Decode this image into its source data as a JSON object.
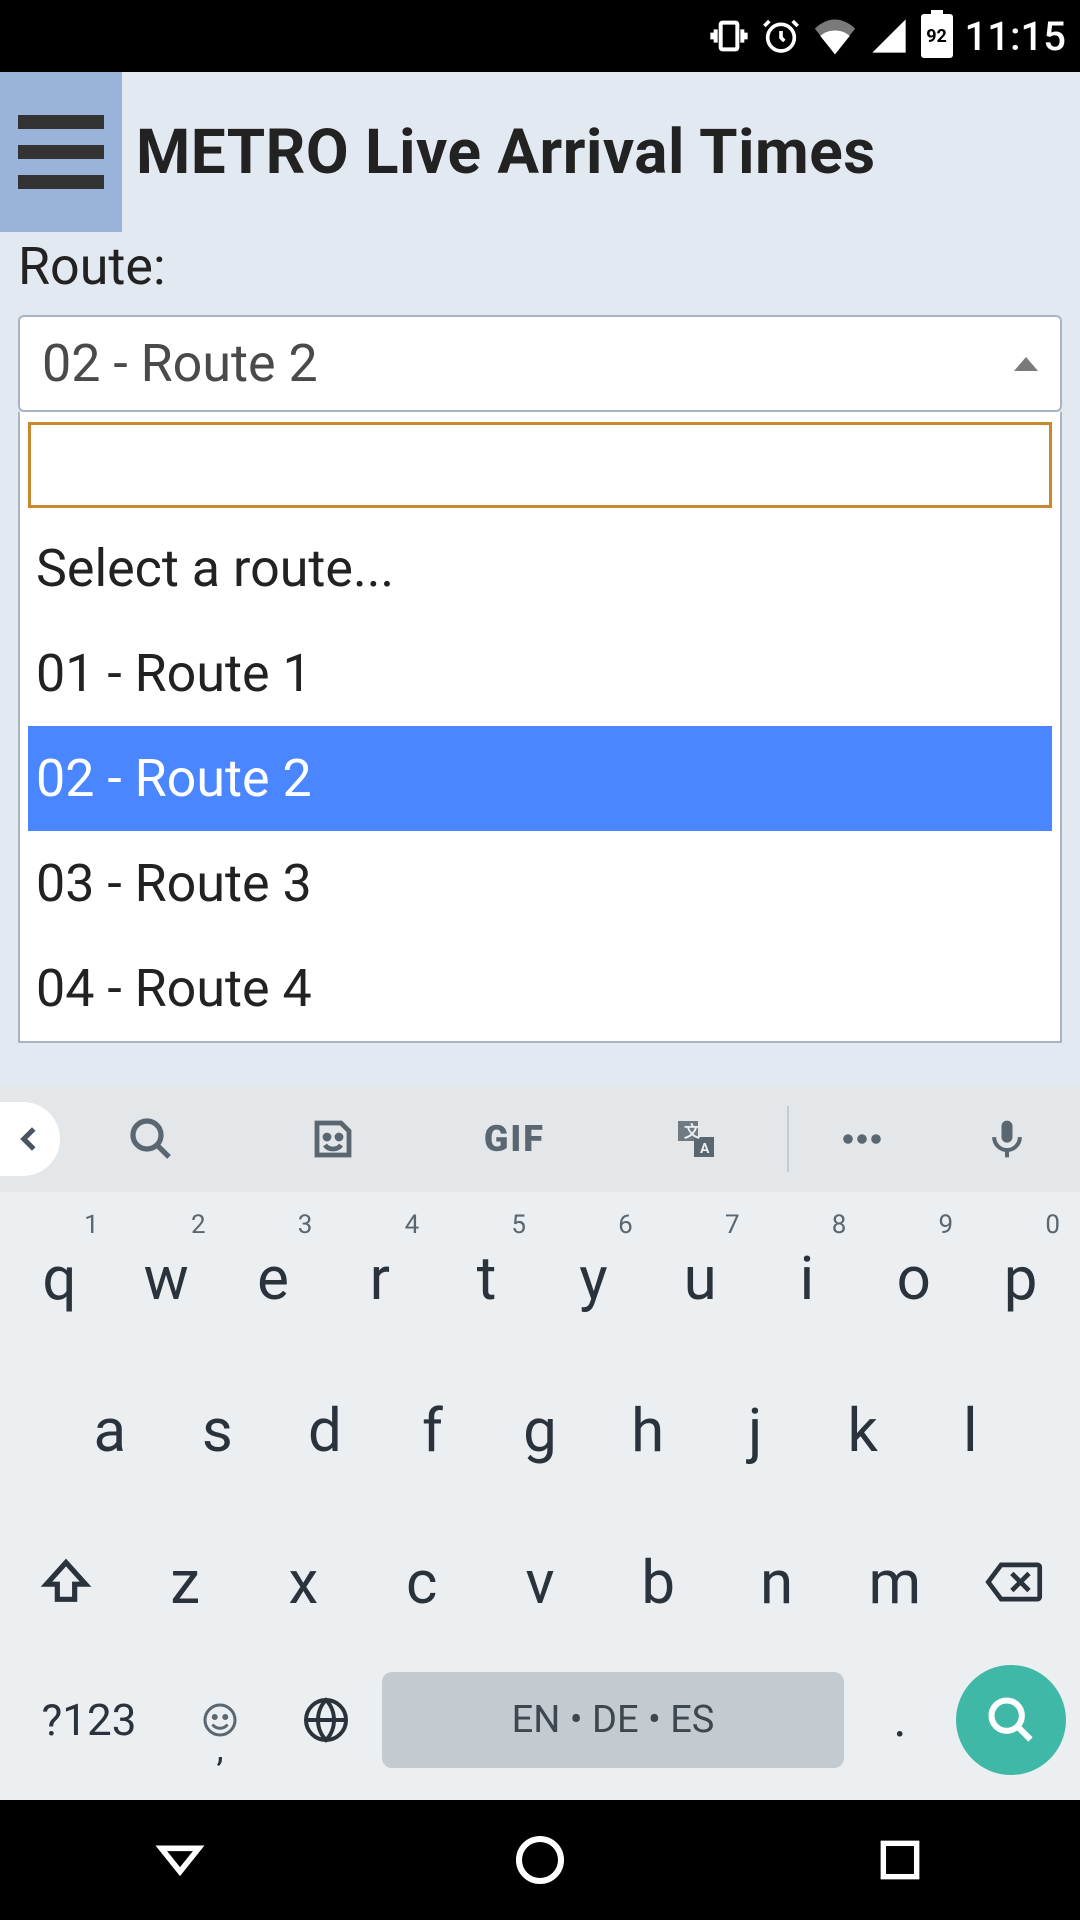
{
  "status": {
    "time": "11:15",
    "battery": "92"
  },
  "header": {
    "title": "METRO Live Arrival Times"
  },
  "route": {
    "label": "Route:",
    "selected": "02 - Route 2",
    "search_value": "",
    "placeholder_option": "Select a route...",
    "options": [
      "01 - Route 1",
      "02 - Route 2",
      "03 - Route 3",
      "04 - Route 4"
    ]
  },
  "keyboard": {
    "gif": "GIF",
    "row1": [
      {
        "k": "q",
        "n": "1"
      },
      {
        "k": "w",
        "n": "2"
      },
      {
        "k": "e",
        "n": "3"
      },
      {
        "k": "r",
        "n": "4"
      },
      {
        "k": "t",
        "n": "5"
      },
      {
        "k": "y",
        "n": "6"
      },
      {
        "k": "u",
        "n": "7"
      },
      {
        "k": "i",
        "n": "8"
      },
      {
        "k": "o",
        "n": "9"
      },
      {
        "k": "p",
        "n": "0"
      }
    ],
    "row2": [
      "a",
      "s",
      "d",
      "f",
      "g",
      "h",
      "j",
      "k",
      "l"
    ],
    "row3": [
      "z",
      "x",
      "c",
      "v",
      "b",
      "n",
      "m"
    ],
    "numsym": "?123",
    "comma": ",",
    "space": "EN • DE • ES",
    "dot": "."
  }
}
